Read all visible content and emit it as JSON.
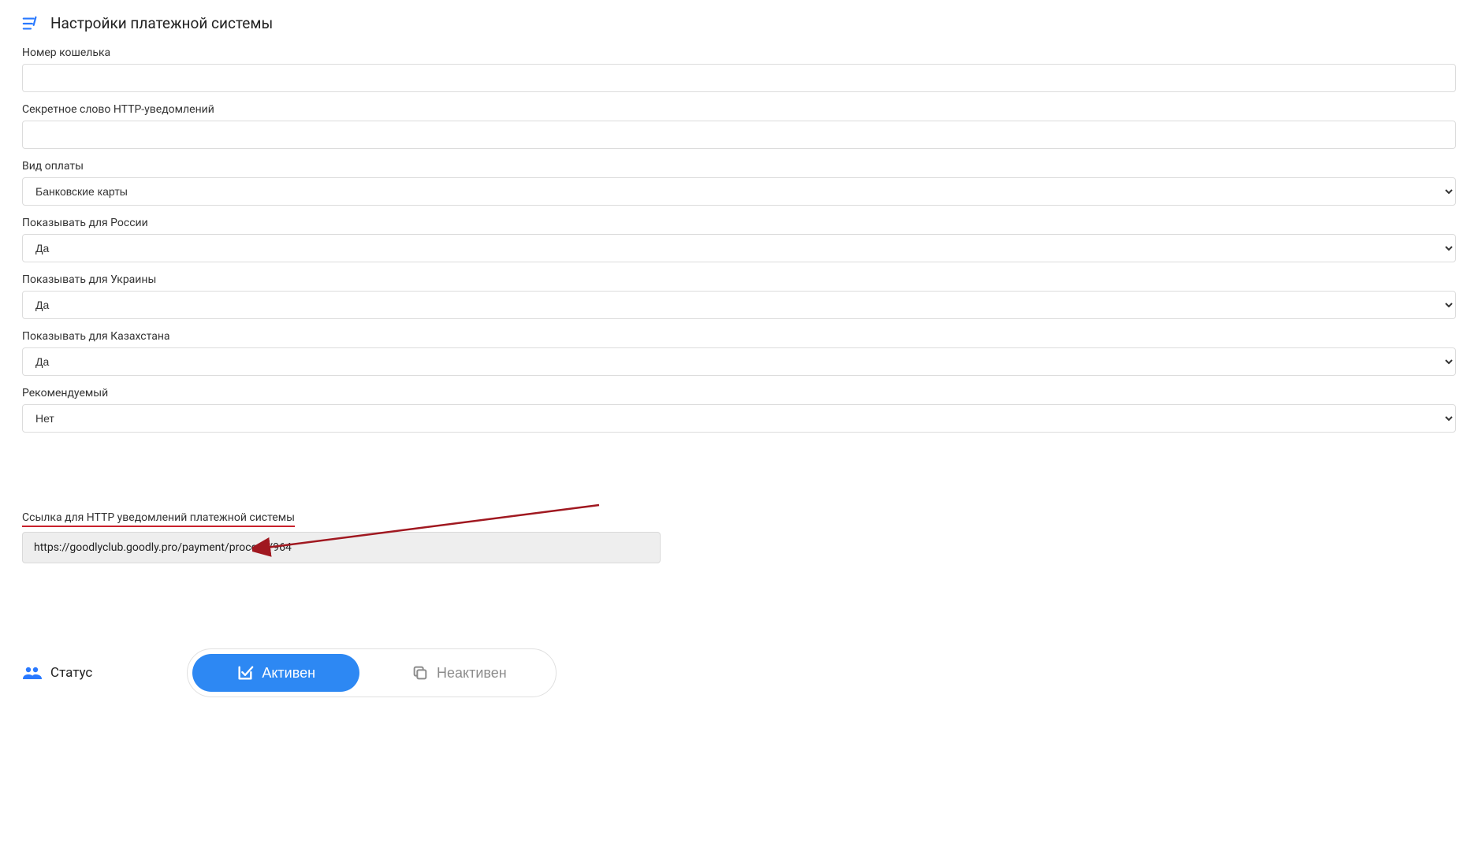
{
  "header": {
    "title": "Настройки платежной системы"
  },
  "form": {
    "wallet": {
      "label": "Номер кошелька",
      "value": ""
    },
    "secret": {
      "label": "Секретное слово HTTP-уведомлений",
      "value": ""
    },
    "paytype": {
      "label": "Вид оплаты",
      "value": "Банковские карты"
    },
    "show_ru": {
      "label": "Показывать для России",
      "value": "Да"
    },
    "show_ua": {
      "label": "Показывать для Украины",
      "value": "Да"
    },
    "show_kz": {
      "label": "Показывать для Казахстана",
      "value": "Да"
    },
    "recommended": {
      "label": "Рекомендуемый",
      "value": "Нет"
    }
  },
  "notify": {
    "label": "Ссылка для HTTP уведомлений платежной системы",
    "url": "https://goodlyclub.goodly.pro/payment/process/964"
  },
  "status": {
    "label": "Статус",
    "active": "Активен",
    "inactive": "Неактивен"
  }
}
